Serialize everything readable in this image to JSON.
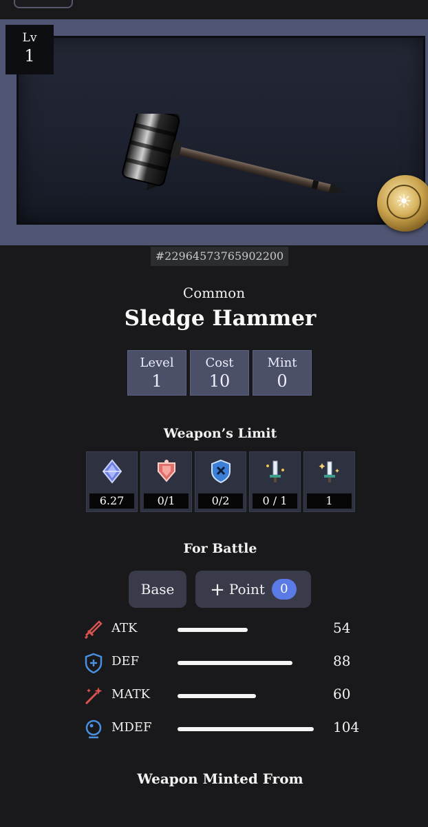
{
  "hero": {
    "level_label": "Lv",
    "level_value": "1",
    "token_id": "#22964573765902200",
    "action_icon": "sun-icon"
  },
  "item": {
    "rarity": "Common",
    "name": "Sledge Hammer"
  },
  "summary": [
    {
      "label": "Level",
      "value": "1"
    },
    {
      "label": "Cost",
      "value": "10"
    },
    {
      "label": "Mint",
      "value": "0"
    }
  ],
  "limits": {
    "title": "Weapon’s Limit",
    "items": [
      {
        "icon": "crystal-icon",
        "value": "6.27"
      },
      {
        "icon": "armor-icon",
        "value": "0/1"
      },
      {
        "icon": "shield-icon",
        "value": "0/2"
      },
      {
        "icon": "sword-upgrade-icon",
        "value": "0 / 1"
      },
      {
        "icon": "sword-sparkle-icon",
        "value": "1"
      }
    ]
  },
  "battle": {
    "title": "For Battle",
    "base_label": "Base",
    "point_label": "Point",
    "point_count": "0",
    "stats": [
      {
        "name": "ATK",
        "value": "54",
        "icon": "sword-icon",
        "color": "#d9534f"
      },
      {
        "name": "DEF",
        "value": "88",
        "icon": "shield-plus-icon",
        "color": "#4a8fe0"
      },
      {
        "name": "MATK",
        "value": "60",
        "icon": "magic-wand-icon",
        "color": "#d9534f"
      },
      {
        "name": "MDEF",
        "value": "104",
        "icon": "orb-icon",
        "color": "#4a8fe0"
      }
    ]
  },
  "minted": {
    "title": "Weapon Minted From"
  }
}
